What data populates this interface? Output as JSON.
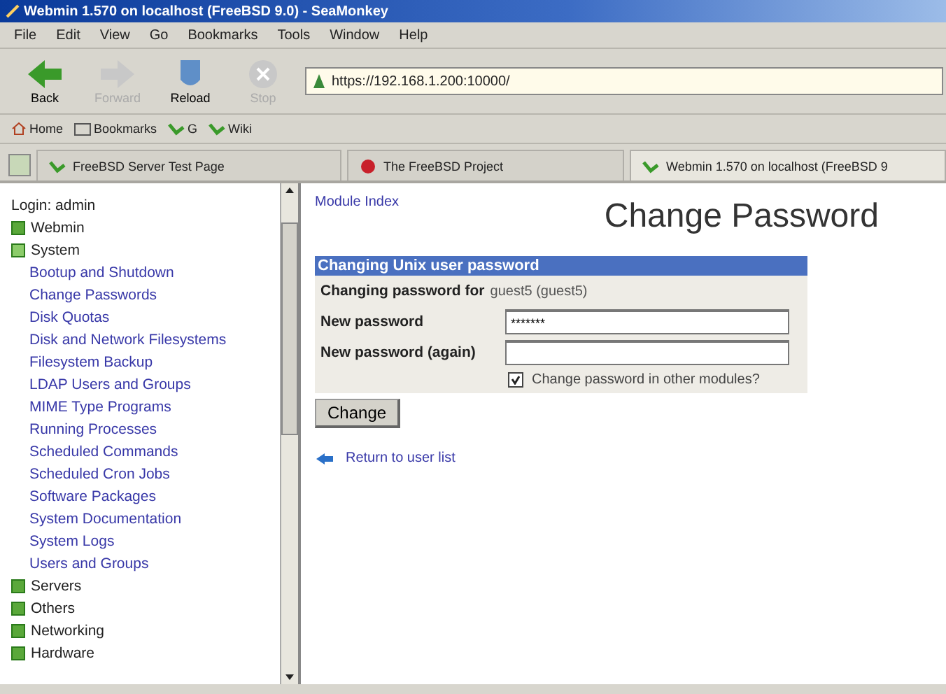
{
  "window": {
    "title": "Webmin 1.570 on localhost (FreeBSD 9.0) - SeaMonkey"
  },
  "menu": [
    "File",
    "Edit",
    "View",
    "Go",
    "Bookmarks",
    "Tools",
    "Window",
    "Help"
  ],
  "nav_buttons": [
    {
      "label": "Back",
      "disabled": false,
      "kind": "back"
    },
    {
      "label": "Forward",
      "disabled": true,
      "kind": "forward"
    },
    {
      "label": "Reload",
      "disabled": false,
      "kind": "reload"
    },
    {
      "label": "Stop",
      "disabled": true,
      "kind": "stop"
    }
  ],
  "address": {
    "value": "https://192.168.1.200:10000/"
  },
  "bookmarks": [
    {
      "label": "Home",
      "kind": "home"
    },
    {
      "label": "Bookmarks",
      "kind": "folder"
    },
    {
      "label": "G",
      "kind": "link"
    },
    {
      "label": "Wiki",
      "kind": "link"
    }
  ],
  "tabs": [
    {
      "label": "FreeBSD Server Test Page",
      "selected": false,
      "kind": "link"
    },
    {
      "label": "The FreeBSD Project",
      "selected": false,
      "kind": "daemon"
    },
    {
      "label": "Webmin 1.570 on localhost (FreeBSD 9",
      "selected": true,
      "kind": "link"
    }
  ],
  "sidebar": {
    "login": "Login: admin",
    "categories": [
      {
        "label": "Webmin",
        "expanded": false
      },
      {
        "label": "System",
        "expanded": true,
        "children": [
          "Bootup and Shutdown",
          "Change Passwords",
          "Disk Quotas",
          "Disk and Network Filesystems",
          "Filesystem Backup",
          "LDAP Users and Groups",
          "MIME Type Programs",
          "Running Processes",
          "Scheduled Commands",
          "Scheduled Cron Jobs",
          "Software Packages",
          "System Documentation",
          "System Logs",
          "Users and Groups"
        ]
      },
      {
        "label": "Servers",
        "expanded": false
      },
      {
        "label": "Others",
        "expanded": false
      },
      {
        "label": "Networking",
        "expanded": false
      },
      {
        "label": "Hardware",
        "expanded": false
      }
    ]
  },
  "page": {
    "module_index": "Module Index",
    "title": "Change Password",
    "form": {
      "header": "Changing Unix user password",
      "user_label": "Changing password for",
      "user_value": "guest5 (guest5)",
      "fields": [
        {
          "label": "New password",
          "value": "*******"
        },
        {
          "label": "New password (again)"
        }
      ],
      "checkbox": {
        "label": "Change password in other modules?",
        "checked": true
      }
    },
    "submit": "Change",
    "return_link": "Return to user list"
  }
}
